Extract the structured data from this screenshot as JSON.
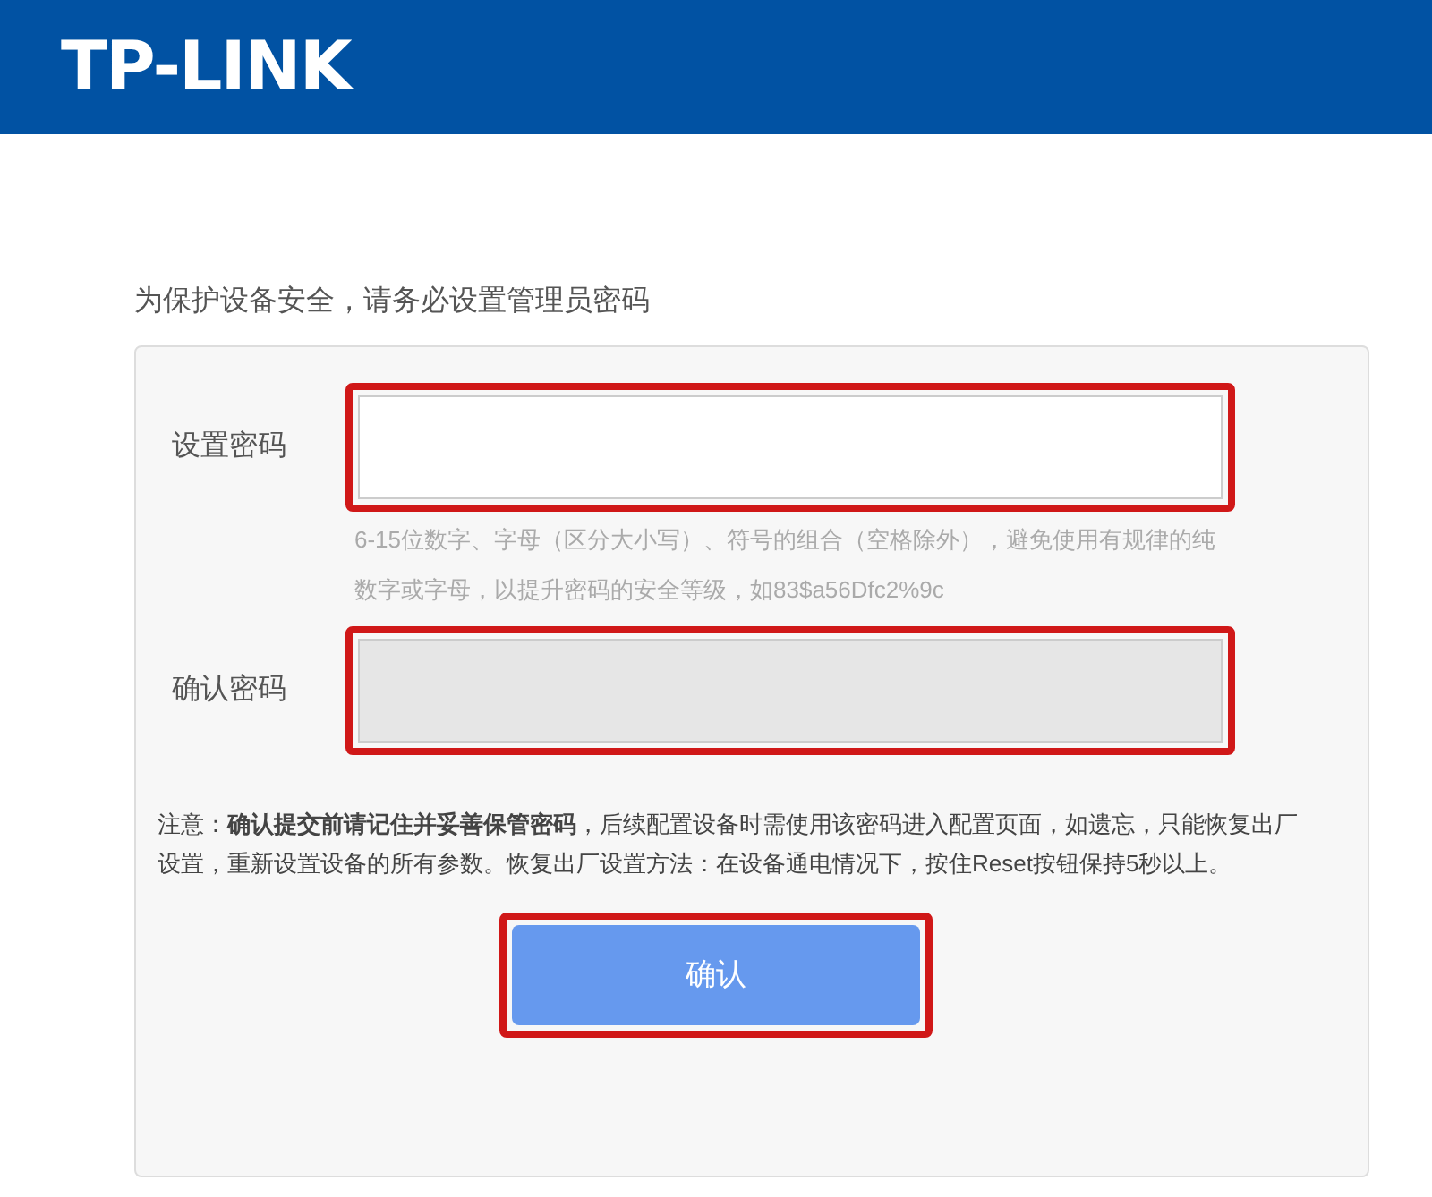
{
  "header": {
    "logo": "TP-LINK"
  },
  "prompt": "为保护设备安全，请务必设置管理员密码",
  "fields": [
    {
      "label": "设置密码",
      "disabled": false,
      "highlighted": true,
      "hint": "6-15位数字、字母（区分大小写）、符号的组合（空格除外），避免使用有规律的纯数字或字母，以提升密码的安全等级，如83$a56Dfc2%9c"
    },
    {
      "label": "确认密码",
      "disabled": true,
      "highlighted": true
    }
  ],
  "note": "注意：**确认提交前请记住并妥善保管密码**，后续配置设备时需使用该密码进入配置页面，如遗忘，只能恢复出厂设置，重新设置设备的所有参数。恢复出厂设置方法：在设备通电情况下，按住Reset按钮保持5秒以上。",
  "submit": {
    "label": "确认",
    "highlighted": true
  }
}
